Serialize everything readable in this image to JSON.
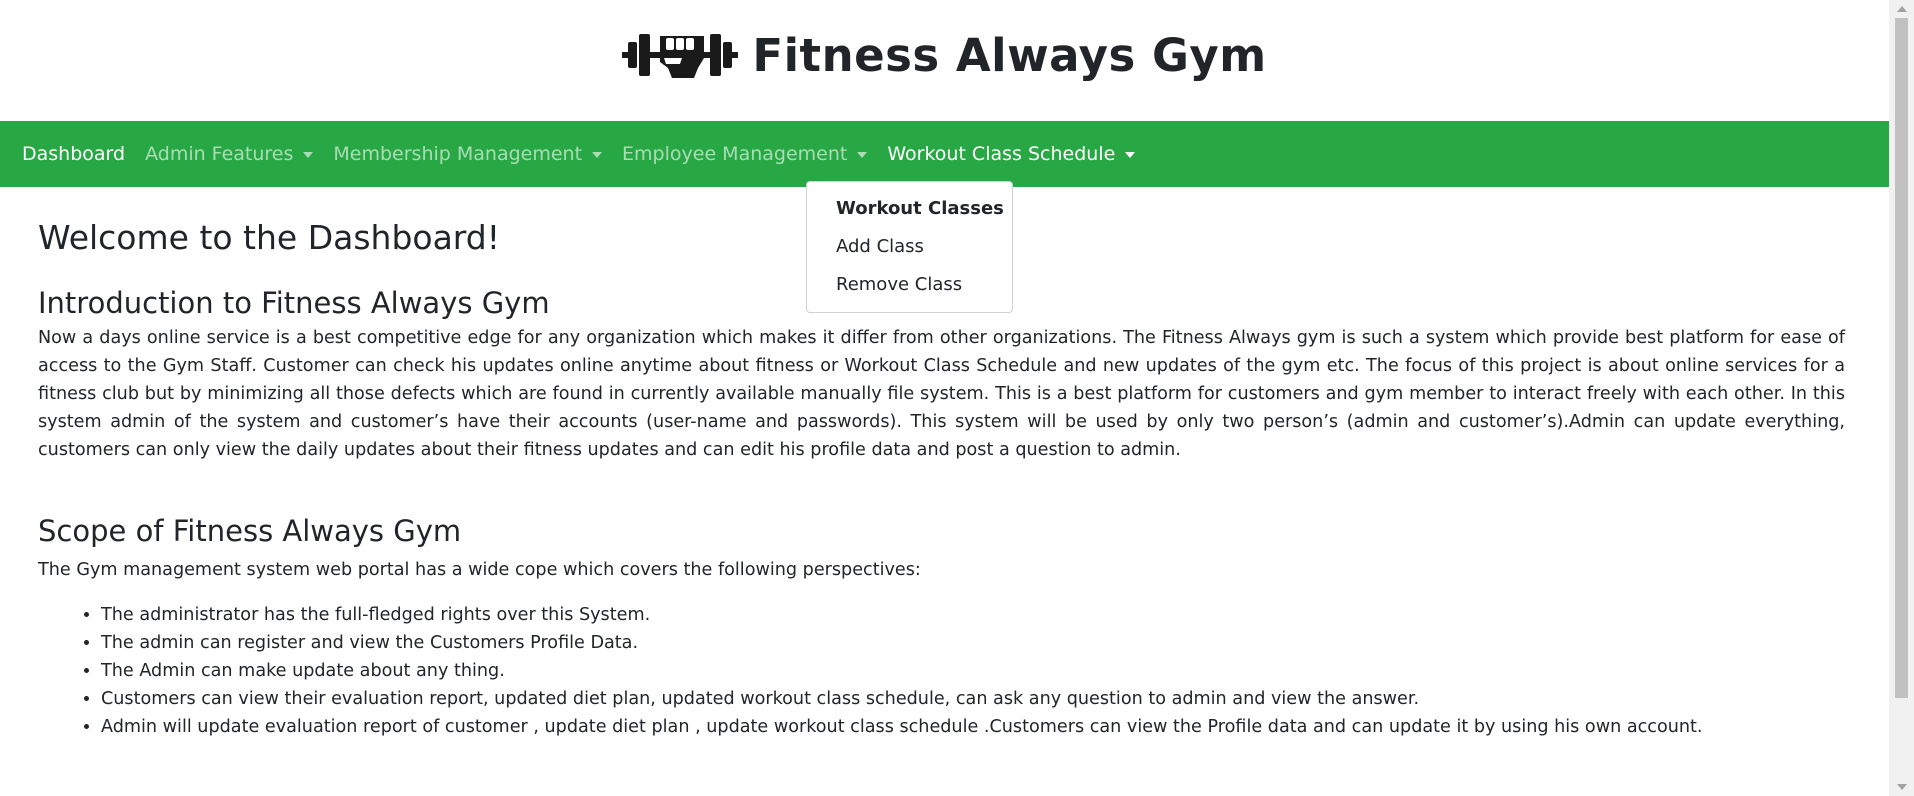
{
  "brand": {
    "icon": "dumbbell-fist-icon",
    "title": "Fitness Always Gym"
  },
  "navbar": {
    "items": [
      {
        "label": "Dashboard",
        "dropdown": false,
        "active": true
      },
      {
        "label": "Admin Features",
        "dropdown": true,
        "active": false
      },
      {
        "label": "Membership Management",
        "dropdown": true,
        "active": false
      },
      {
        "label": "Employee Management",
        "dropdown": true,
        "active": false
      },
      {
        "label": "Workout Class Schedule",
        "dropdown": true,
        "active": true
      }
    ]
  },
  "dropdown": {
    "items": [
      {
        "label": "Workout Classes",
        "header": true
      },
      {
        "label": "Add Class",
        "header": false
      },
      {
        "label": "Remove Class",
        "header": false
      }
    ]
  },
  "main": {
    "welcome": "Welcome to the Dashboard!",
    "intro_title": "Introduction to Fitness Always Gym",
    "intro_text": "Now a days online service is a best competitive edge for any organization which makes it differ from other organizations. The Fitness Always gym is such a system which provide best platform for ease of access to the Gym Staff. Customer can check his updates online anytime about fitness or Workout Class Schedule and new updates of the gym etc. The focus of this project is about online services for a fitness club but by minimizing all those defects which are found in currently available manually file system. This is a best platform for customers and gym member to interact freely with each other. In this system admin of the system and customer’s have their accounts (user-name and passwords). This system will be used by only two person’s (admin and customer’s).Admin can update everything, customers can only view the daily updates about their fitness updates and can edit his profile data and post a question to admin.",
    "scope_title": "Scope of Fitness Always Gym",
    "scope_intro": "The Gym management system web portal has a wide cope which covers the following perspectives:",
    "scope_items": [
      "The administrator has the full-fledged rights over this System.",
      "The admin can register and view the Customers Profile Data.",
      "The Admin can make update about any thing.",
      "Customers can view their evaluation report, updated diet plan, updated workout class schedule, can ask any question to admin and view the answer.",
      "Admin will update evaluation report of customer , update diet plan , update workout class schedule .Customers can view the Profile data and can update it by using his own account."
    ]
  },
  "colors": {
    "navbar_bg": "#28a745",
    "text": "#212529"
  }
}
